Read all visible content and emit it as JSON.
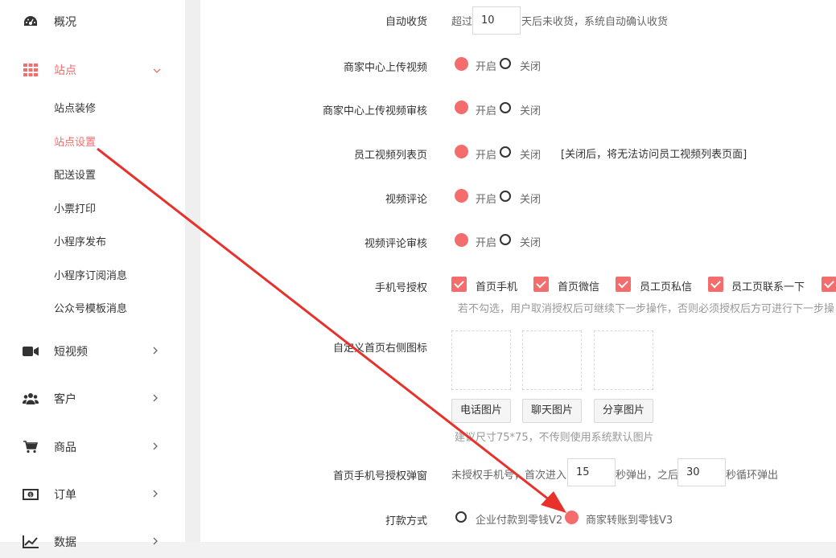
{
  "sidebar": {
    "items": [
      {
        "label": "概况",
        "icon": "dashboard-icon"
      },
      {
        "label": "站点",
        "icon": "grid-icon",
        "active": true,
        "expanded": true
      },
      {
        "label": "短视频",
        "icon": "video-icon"
      },
      {
        "label": "客户",
        "icon": "users-icon"
      },
      {
        "label": "商品",
        "icon": "cart-icon"
      },
      {
        "label": "订单",
        "icon": "money-icon"
      },
      {
        "label": "数据",
        "icon": "chart-icon"
      }
    ],
    "sub_items": [
      {
        "label": "站点装修"
      },
      {
        "label": "站点设置",
        "active": true
      },
      {
        "label": "配送设置"
      },
      {
        "label": "小票打印"
      },
      {
        "label": "小程序发布"
      },
      {
        "label": "小程序订阅消息"
      },
      {
        "label": "公众号模板消息"
      }
    ]
  },
  "form": {
    "auto_receive": {
      "label": "自动收货",
      "prefix": "超过",
      "value": "10",
      "suffix": "天后未收货，系统自动确认收货"
    },
    "upload_video": {
      "label": "商家中心上传视频",
      "on": "开启",
      "off": "关闭"
    },
    "upload_video_review": {
      "label": "商家中心上传视频审核",
      "on": "开启",
      "off": "关闭"
    },
    "staff_video_list": {
      "label": "员工视频列表页",
      "on": "开启",
      "off": "关闭",
      "note": "[关闭后，将无法访问员工视频列表页面]"
    },
    "video_comment": {
      "label": "视频评论",
      "on": "开启",
      "off": "关闭"
    },
    "video_comment_review": {
      "label": "视频评论审核",
      "on": "开启",
      "off": "关闭"
    },
    "phone_auth": {
      "label": "手机号授权",
      "options": [
        "首页手机",
        "首页微信",
        "员工页私信",
        "员工页联系一下"
      ],
      "hint": "若不勾选，用户取消授权后可继续下一步操作，否则必须授权后方可进行下一步操"
    },
    "home_icons": {
      "label": "自定义首页右侧图标",
      "buttons": [
        "电话图片",
        "聊天图片",
        "分享图片"
      ],
      "hint": "建议尺寸75*75，不传则使用系统默认图片"
    },
    "phone_popup": {
      "label": "首页手机号授权弹窗",
      "prefix": "未授权手机号，首次进入",
      "first_value": "15",
      "middle": "秒弹出，之后",
      "loop_value": "30",
      "suffix": "秒循环弹出"
    },
    "payment": {
      "label": "打款方式",
      "option1": "企业付款到零钱V2",
      "option2": "商家转账到零钱V3"
    }
  },
  "colors": {
    "accent": "#f56c6c",
    "arrow": "#e8312a"
  }
}
